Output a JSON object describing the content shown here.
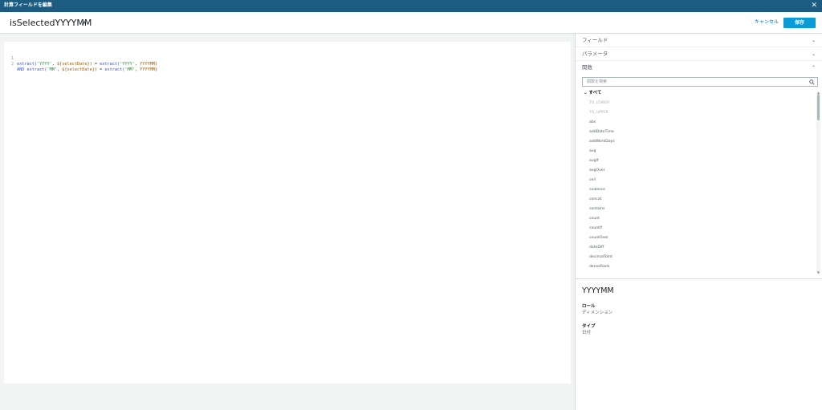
{
  "window": {
    "title": "計算フィールドを編集",
    "close_glyph": "✕"
  },
  "header": {
    "field_name": "isSelectedYYYYMM",
    "cancel_label": "キャンセル",
    "save_label": "保存"
  },
  "editor": {
    "lines": [
      {
        "number": "1",
        "tokens": [
          {
            "t": "extract(",
            "c": "k"
          },
          {
            "t": "'YYYY'",
            "c": "s"
          },
          {
            "t": ", ",
            "c": "p"
          },
          {
            "t": "${selectDate}",
            "c": "v"
          },
          {
            "t": ") = ",
            "c": "p"
          },
          {
            "t": "extract(",
            "c": "k"
          },
          {
            "t": "'YYYY'",
            "c": "s"
          },
          {
            "t": ", ",
            "c": "p"
          },
          {
            "t": "YYYYMM",
            "c": "v"
          },
          {
            "t": ")",
            "c": "p"
          }
        ]
      },
      {
        "number": "2",
        "tokens": [
          {
            "t": "AND ",
            "c": "k"
          },
          {
            "t": "extract(",
            "c": "k"
          },
          {
            "t": "'MM'",
            "c": "s"
          },
          {
            "t": ", ",
            "c": "p"
          },
          {
            "t": "${selectDate}",
            "c": "v"
          },
          {
            "t": ") = ",
            "c": "p"
          },
          {
            "t": "extract(",
            "c": "k"
          },
          {
            "t": "'MM'",
            "c": "s"
          },
          {
            "t": ", ",
            "c": "p"
          },
          {
            "t": "YYYYMM",
            "c": "v"
          },
          {
            "t": ")",
            "c": "p"
          }
        ]
      }
    ]
  },
  "panel": {
    "sections": [
      {
        "label": "フィールド",
        "chevron": "⌄"
      },
      {
        "label": "パラメータ",
        "chevron": "⌄"
      },
      {
        "label": "関数",
        "chevron": "⌃"
      }
    ],
    "search_placeholder": "関数を検索",
    "tree_label": "すべて",
    "functions": [
      {
        "name": "TO_LOWER",
        "dim": true
      },
      {
        "name": "TO_UPPER",
        "dim": true
      },
      {
        "name": "abs",
        "dim": false
      },
      {
        "name": "addDateTime",
        "dim": false
      },
      {
        "name": "addWorkDays",
        "dim": false
      },
      {
        "name": "avg",
        "dim": false
      },
      {
        "name": "avgIf",
        "dim": false
      },
      {
        "name": "avgOver",
        "dim": false
      },
      {
        "name": "ceil",
        "dim": false
      },
      {
        "name": "coalesce",
        "dim": false
      },
      {
        "name": "concat",
        "dim": false
      },
      {
        "name": "contains",
        "dim": false
      },
      {
        "name": "count",
        "dim": false
      },
      {
        "name": "countIf",
        "dim": false
      },
      {
        "name": "countOver",
        "dim": false
      },
      {
        "name": "dateDiff",
        "dim": false
      },
      {
        "name": "decimalToInt",
        "dim": false
      },
      {
        "name": "denseRank",
        "dim": false
      }
    ]
  },
  "detail": {
    "name": "YYYYMM",
    "role_label": "ロール",
    "role_value": "ディメンション",
    "type_label": "タイプ",
    "type_value": "日付"
  },
  "colors": {
    "titlebar": "#1b5c80",
    "accent": "#0a9bd9",
    "link": "#0073bb"
  }
}
